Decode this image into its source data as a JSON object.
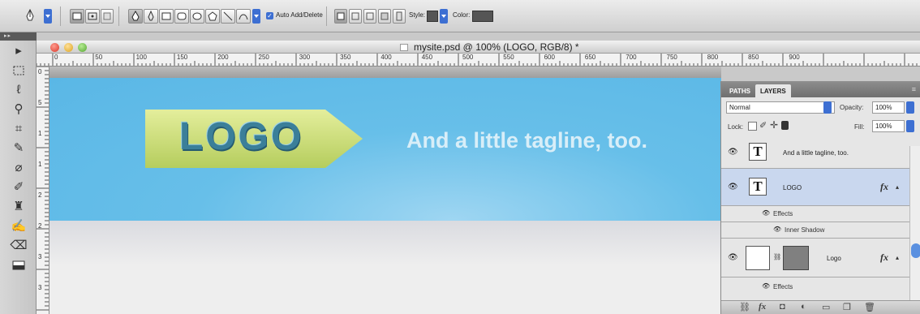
{
  "options_bar": {
    "tool_icon": "pen-tool-icon",
    "auto_add_delete_label": "Auto Add/Delete",
    "auto_add_delete_checked": true,
    "style_label": "Style:",
    "color_label": "Color:",
    "color_value": "#555555"
  },
  "toolbox": {
    "tools": [
      "move-tool-icon",
      "marquee-tool-icon",
      "lasso-tool-icon",
      "quick-selection-tool-icon",
      "crop-tool-icon",
      "eyedropper-tool-icon",
      "healing-brush-tool-icon",
      "brush-tool-icon",
      "clone-stamp-tool-icon",
      "history-brush-tool-icon",
      "eraser-tool-icon",
      "gradient-tool-icon"
    ]
  },
  "document": {
    "title": "mysite.psd @ 100% (LOGO, RGB/8) *",
    "ruler_marks": [
      "0",
      "50",
      "100",
      "150",
      "200",
      "250",
      "300",
      "350",
      "400",
      "450",
      "500",
      "550",
      "600",
      "650",
      "700",
      "750",
      "800",
      "850",
      "900"
    ],
    "vruler_marks": [
      "0",
      "5",
      "1",
      "1",
      "2",
      "2",
      "3",
      "3"
    ],
    "logo_text": "LOGO",
    "tagline": "And a little tagline, too.",
    "banner_color": "#5ab7e6",
    "logo_color": "#c9dd7a"
  },
  "layers_panel": {
    "tabs": [
      "PATHS",
      "LAYERS"
    ],
    "active_tab": "LAYERS",
    "blend_mode": "Normal",
    "opacity_label": "Opacity:",
    "opacity_value": "100%",
    "lock_label": "Lock:",
    "fill_label": "Fill:",
    "fill_value": "100%",
    "layers": [
      {
        "name": "And a little tagline, too.",
        "thumb": "T"
      },
      {
        "name": "LOGO",
        "thumb": "T",
        "fx": "fx",
        "effects_label": "Effects",
        "effect": "Inner Shadow",
        "selected": true
      },
      {
        "name": "Logo",
        "fx": "fx",
        "effects_label": "Effects"
      }
    ]
  }
}
